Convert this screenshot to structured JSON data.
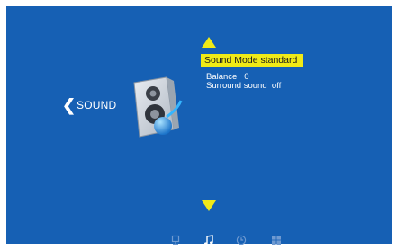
{
  "colors": {
    "background": "#1660b4",
    "accent": "#f0ea16",
    "text": "#ffffff",
    "inactive_icon": "#6f9ad1"
  },
  "nav": {
    "back_icon": "chevron-left-icon",
    "back_glyph": "❮",
    "back_label": "SOUND"
  },
  "menu": {
    "category_icon": "speaker-icon",
    "scroll_up_icon": "triangle-up-icon",
    "scroll_down_icon": "triangle-down-icon",
    "selected_item": "Sound Mode standard",
    "items": [
      {
        "label": "Balance",
        "value": "0"
      },
      {
        "label": "Surround sound",
        "value": "off"
      }
    ]
  },
  "tabs": [
    {
      "name": "monitor-icon",
      "active": false
    },
    {
      "name": "music-note-icon",
      "active": true
    },
    {
      "name": "clock-icon",
      "active": false
    },
    {
      "name": "grid-icon",
      "active": false
    }
  ]
}
